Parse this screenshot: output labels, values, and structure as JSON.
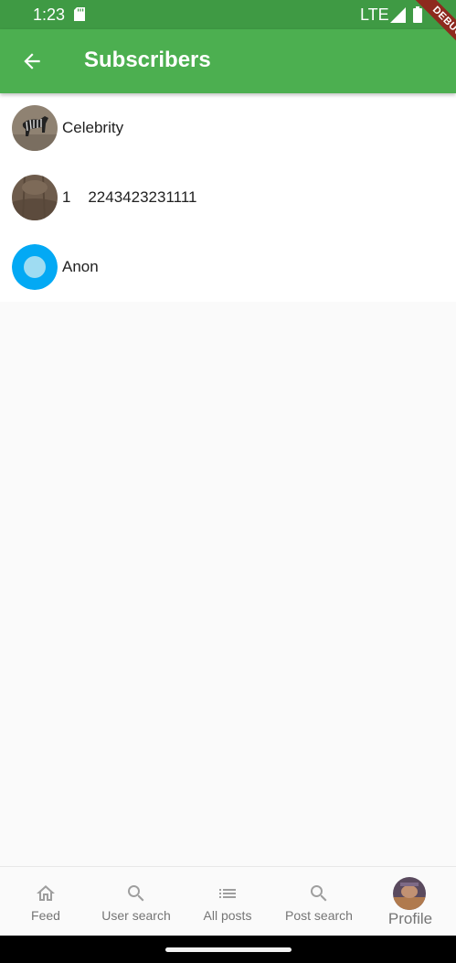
{
  "status_bar": {
    "time": "1:23",
    "network": "LTE",
    "sd_icon": "sd-card-icon",
    "signal_icon": "signal-icon",
    "battery_icon": "battery-icon"
  },
  "debug_banner": "DEBUG",
  "app_bar": {
    "back_icon": "arrow-back-icon",
    "title": "Subscribers",
    "color": "#4caf50"
  },
  "subscribers": [
    {
      "name": "Celebrity",
      "avatar": "zebra-photo"
    },
    {
      "name": "1    2243423231111",
      "avatar": "brown-photo"
    },
    {
      "name": "Anon",
      "avatar": "default-blue-avatar",
      "avatar_color": "#03a9f4"
    }
  ],
  "bottom_nav": [
    {
      "label": "Feed",
      "icon": "home-icon"
    },
    {
      "label": "User search",
      "icon": "search-icon"
    },
    {
      "label": "All posts",
      "icon": "list-icon"
    },
    {
      "label": "Post search",
      "icon": "search-icon"
    },
    {
      "label": "Profile",
      "icon": "profile-avatar"
    }
  ]
}
